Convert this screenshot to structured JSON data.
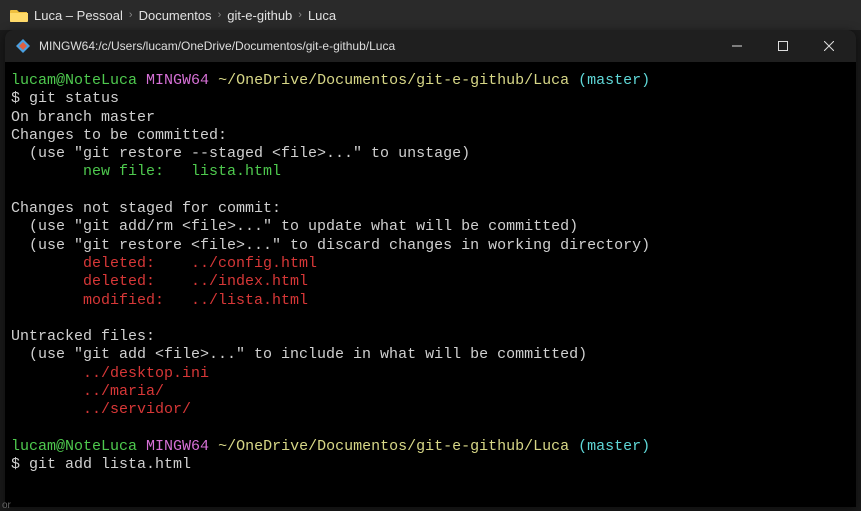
{
  "breadcrumb": {
    "items": [
      "Luca – Pessoal",
      "Documentos",
      "git-e-github",
      "Luca"
    ]
  },
  "titlebar": {
    "title": "MINGW64:/c/Users/lucam/OneDrive/Documentos/git-e-github/Luca"
  },
  "prompt": {
    "user_host": "lucam@NoteLuca",
    "env": "MINGW64",
    "path": "~/OneDrive/Documentos/git-e-github/Luca",
    "branch": "(master)",
    "symbol": "$"
  },
  "commands": {
    "cmd1": "git status",
    "cmd2": "git add lista.html"
  },
  "output": {
    "on_branch": "On branch master",
    "to_commit_header": "Changes to be committed:",
    "to_commit_hint": "  (use \"git restore --staged <file>...\" to unstage)",
    "staged_new": "        new file:   lista.html",
    "not_staged_header": "Changes not staged for commit:",
    "not_staged_hint1": "  (use \"git add/rm <file>...\" to update what will be committed)",
    "not_staged_hint2": "  (use \"git restore <file>...\" to discard changes in working directory)",
    "deleted1": "        deleted:    ../config.html",
    "deleted2": "        deleted:    ../index.html",
    "modified1": "        modified:   ../lista.html",
    "untracked_header": "Untracked files:",
    "untracked_hint": "  (use \"git add <file>...\" to include in what will be committed)",
    "untracked1": "        ../desktop.ini",
    "untracked2": "        ../maria/",
    "untracked3": "        ../servidor/"
  },
  "footer": {
    "text": "or"
  }
}
